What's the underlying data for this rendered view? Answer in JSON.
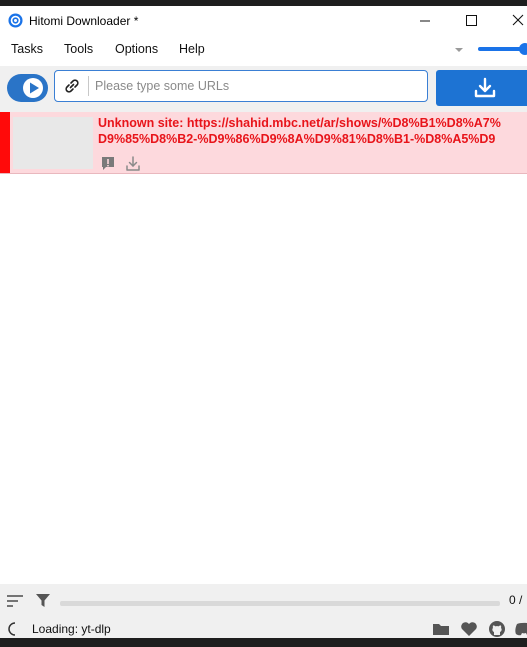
{
  "window": {
    "title": "Hitomi Downloader *"
  },
  "menu": {
    "items": [
      "Tasks",
      "Tools",
      "Options",
      "Help"
    ]
  },
  "url_bar": {
    "placeholder": "Please type some URLs",
    "value": ""
  },
  "task": {
    "line1": "Unknown site: https://shahid.mbc.net/ar/shows/%D8%B1%D8%A7%",
    "line2": "D9%85%D8%B2-%D9%86%D9%8A%D9%81%D8%B1-%D8%A5%D9",
    "status_color": "#ff0a0a"
  },
  "status": {
    "progress_count": "0 /",
    "loading_text": "Loading: yt-dlp",
    "progress_fraction": 0
  },
  "colors": {
    "accent": "#1d73d3",
    "error_bg": "#fdd9dd",
    "error_text": "#e8141a"
  }
}
